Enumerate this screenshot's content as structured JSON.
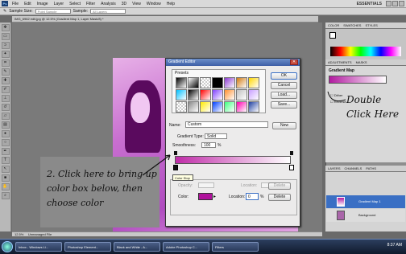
{
  "menubar": {
    "logo": "Ps",
    "items": [
      "File",
      "Edit",
      "Image",
      "Layer",
      "Select",
      "Filter",
      "Analysis",
      "3D",
      "View",
      "Window",
      "Help"
    ],
    "workspace": "ESSENTIALS"
  },
  "options": {
    "sample_size_label": "Sample Size:",
    "sample_size_value": "Point Sample",
    "sample_label": "Sample:",
    "sample_value": "All Layers"
  },
  "document": {
    "tab": "IMG_6962 edit.jpg @ 12.5% (Gradient Map 1, Layer Mask/8) *",
    "status_zoom": "12.5%",
    "status_text": "Unmanaged File"
  },
  "gradient_editor": {
    "title": "Gradient Editor",
    "presets_label": "Presets",
    "buttons": {
      "ok": "OK",
      "cancel": "Cancel",
      "load": "Load...",
      "save": "Save...",
      "new": "New",
      "delete": "Delete"
    },
    "name_label": "Name:",
    "name_value": "Custom",
    "gradient_type_label": "Gradient Type:",
    "gradient_type_value": "Solid",
    "smoothness_label": "Smoothness:",
    "smoothness_value": "100",
    "percent": "%",
    "tooltip": "Color Stop",
    "opacity_label": "Opacity:",
    "location_label": "Location:",
    "color_label": "Color:",
    "location_value": "0",
    "stop_color": "#b0119c",
    "preset_swatches": [
      "#000-#fff",
      "#fff-#000",
      "checker",
      "#000-#000",
      "#8a3ad0",
      "#d07a10",
      "#ffd800",
      "#00c0ff",
      "#000",
      "#ff0000",
      "#8040ff",
      "#ff9030",
      "#c0c0c0",
      "#c9a0ff",
      "checker",
      "#888",
      "#ffeb00",
      "#0040ff",
      "#40ff80",
      "#ff00b0",
      "#2040a0"
    ]
  },
  "panels": {
    "color_tabs": [
      "COLOR",
      "SWATCHES",
      "STYLES"
    ],
    "adjustment_tabs": [
      "ADJUSTMENTS",
      "MASKS"
    ],
    "adjustment_title": "Gradient Map",
    "dither_label": "Dither",
    "reverse_label": "Reverse",
    "layer_tabs": [
      "LAYERS",
      "CHANNELS",
      "PATHS"
    ],
    "layers": [
      "Gradient Map 1",
      "Background"
    ]
  },
  "annotations": {
    "double_click": "Double Click Here",
    "instructions": "2. Click here to bring up color box below, then choose color"
  },
  "taskbar": {
    "tasks": [
      "Inbox - Windows Li...",
      "Photoshop Element...",
      "Black and White - A...",
      "Adobe Photoshop C...",
      "Filters"
    ],
    "clock": "8:37 AM"
  }
}
